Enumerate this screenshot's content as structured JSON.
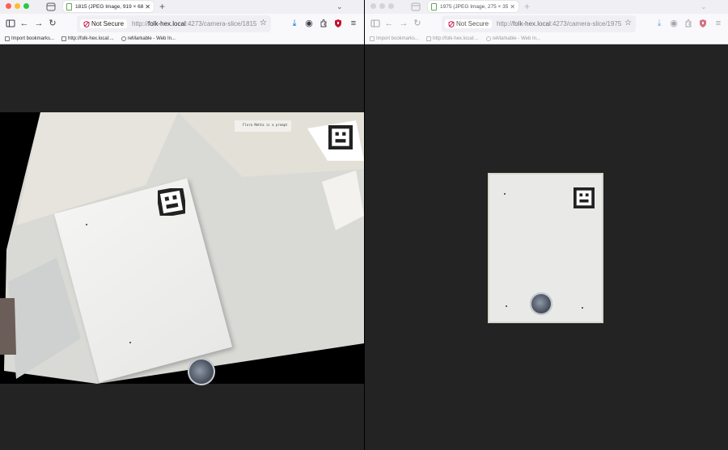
{
  "windows": [
    {
      "tab_title": "1815 (JPEG Image, 919 × 686 p",
      "not_secure": "Not Secure",
      "url_prefix": "http://",
      "url_host": "folk-hex.local",
      "url_path": ":4273/camera-slice/1815",
      "bookmarks": [
        "Import bookmarks...",
        "http://folk-hex.local:...",
        "reMarkable - Web In..."
      ],
      "image_note": "Flora Mehta is a prompt"
    },
    {
      "tab_title": "1975 (JPEG Image, 275 × 359 p",
      "not_secure": "Not Secure",
      "url_prefix": "http://",
      "url_host": "folk-hex.local",
      "url_path": ":4273/camera-slice/1975",
      "bookmarks": [
        "Import bookmarks...",
        "http://folk-hex.local:...",
        "reMarkable - Web In..."
      ]
    }
  ],
  "icons": {
    "traffic_lights": [
      "#ff5f57",
      "#febc2e",
      "#28c840"
    ],
    "nav": [
      "sidebar-icon",
      "back-icon",
      "forward-icon",
      "reload-icon"
    ],
    "toolbar": [
      "download-icon",
      "account-icon",
      "extensions-icon",
      "shield-icon",
      "menu-icon"
    ]
  }
}
